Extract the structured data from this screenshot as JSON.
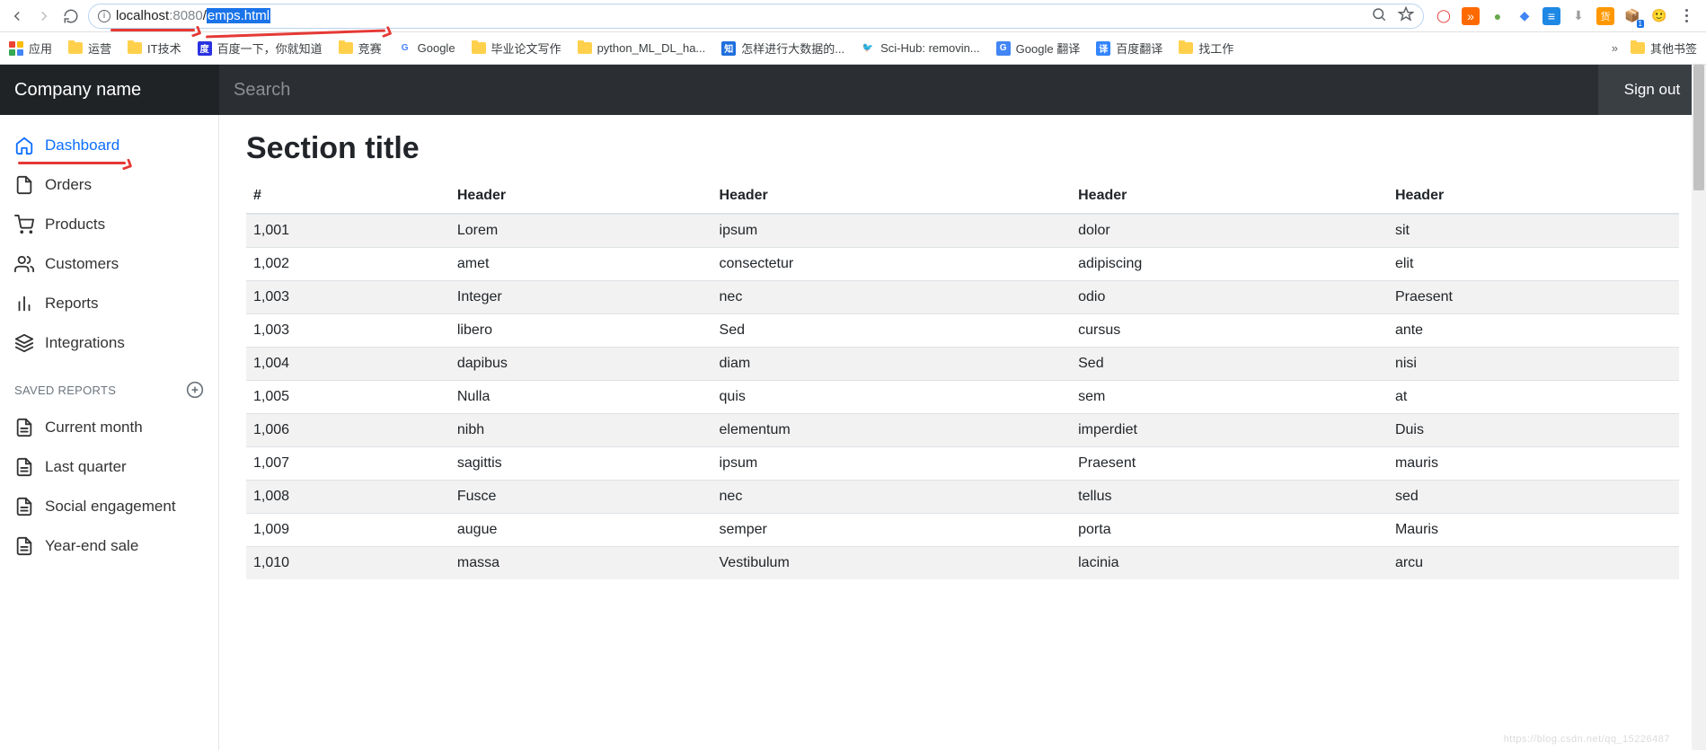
{
  "browser": {
    "url_host": "localhost",
    "url_port": ":8080",
    "url_path_prefix": "/",
    "url_path_selected": "emps.html",
    "bookmarks": [
      {
        "label": "应用",
        "type": "apps"
      },
      {
        "label": "运营",
        "type": "folder"
      },
      {
        "label": "IT技术",
        "type": "folder"
      },
      {
        "label": "百度一下，你就知道",
        "type": "favicon",
        "bg": "#2932e1",
        "ch": "度"
      },
      {
        "label": "竞赛",
        "type": "folder"
      },
      {
        "label": "Google",
        "type": "favicon",
        "bg": "#ffffff",
        "ch": "G"
      },
      {
        "label": "毕业论文写作",
        "type": "folder"
      },
      {
        "label": "python_ML_DL_ha...",
        "type": "folder"
      },
      {
        "label": "怎样进行大数据的...",
        "type": "favicon",
        "bg": "#1f6fde",
        "ch": "知"
      },
      {
        "label": "Sci-Hub: removin...",
        "type": "favicon",
        "bg": "#ffffff",
        "ch": "🐦"
      },
      {
        "label": "Google 翻译",
        "type": "favicon",
        "bg": "#4285f4",
        "ch": "G"
      },
      {
        "label": "百度翻译",
        "type": "favicon",
        "bg": "#3385ff",
        "ch": "译"
      },
      {
        "label": "找工作",
        "type": "folder"
      }
    ],
    "other_bookmarks": "其他书签"
  },
  "header": {
    "brand": "Company name",
    "search_placeholder": "Search",
    "signout": "Sign out"
  },
  "sidebar": {
    "items": [
      {
        "label": "Dashboard"
      },
      {
        "label": "Orders"
      },
      {
        "label": "Products"
      },
      {
        "label": "Customers"
      },
      {
        "label": "Reports"
      },
      {
        "label": "Integrations"
      }
    ],
    "saved_heading": "SAVED REPORTS",
    "saved": [
      {
        "label": "Current month"
      },
      {
        "label": "Last quarter"
      },
      {
        "label": "Social engagement"
      },
      {
        "label": "Year-end sale"
      }
    ]
  },
  "main": {
    "title": "Section title",
    "columns": [
      "#",
      "Header",
      "Header",
      "Header",
      "Header"
    ],
    "rows": [
      [
        "1,001",
        "Lorem",
        "ipsum",
        "dolor",
        "sit"
      ],
      [
        "1,002",
        "amet",
        "consectetur",
        "adipiscing",
        "elit"
      ],
      [
        "1,003",
        "Integer",
        "nec",
        "odio",
        "Praesent"
      ],
      [
        "1,003",
        "libero",
        "Sed",
        "cursus",
        "ante"
      ],
      [
        "1,004",
        "dapibus",
        "diam",
        "Sed",
        "nisi"
      ],
      [
        "1,005",
        "Nulla",
        "quis",
        "sem",
        "at"
      ],
      [
        "1,006",
        "nibh",
        "elementum",
        "imperdiet",
        "Duis"
      ],
      [
        "1,007",
        "sagittis",
        "ipsum",
        "Praesent",
        "mauris"
      ],
      [
        "1,008",
        "Fusce",
        "nec",
        "tellus",
        "sed"
      ],
      [
        "1,009",
        "augue",
        "semper",
        "porta",
        "Mauris"
      ],
      [
        "1,010",
        "massa",
        "Vestibulum",
        "lacinia",
        "arcu"
      ]
    ]
  },
  "watermark": "https://blog.csdn.net/qq_15226487"
}
